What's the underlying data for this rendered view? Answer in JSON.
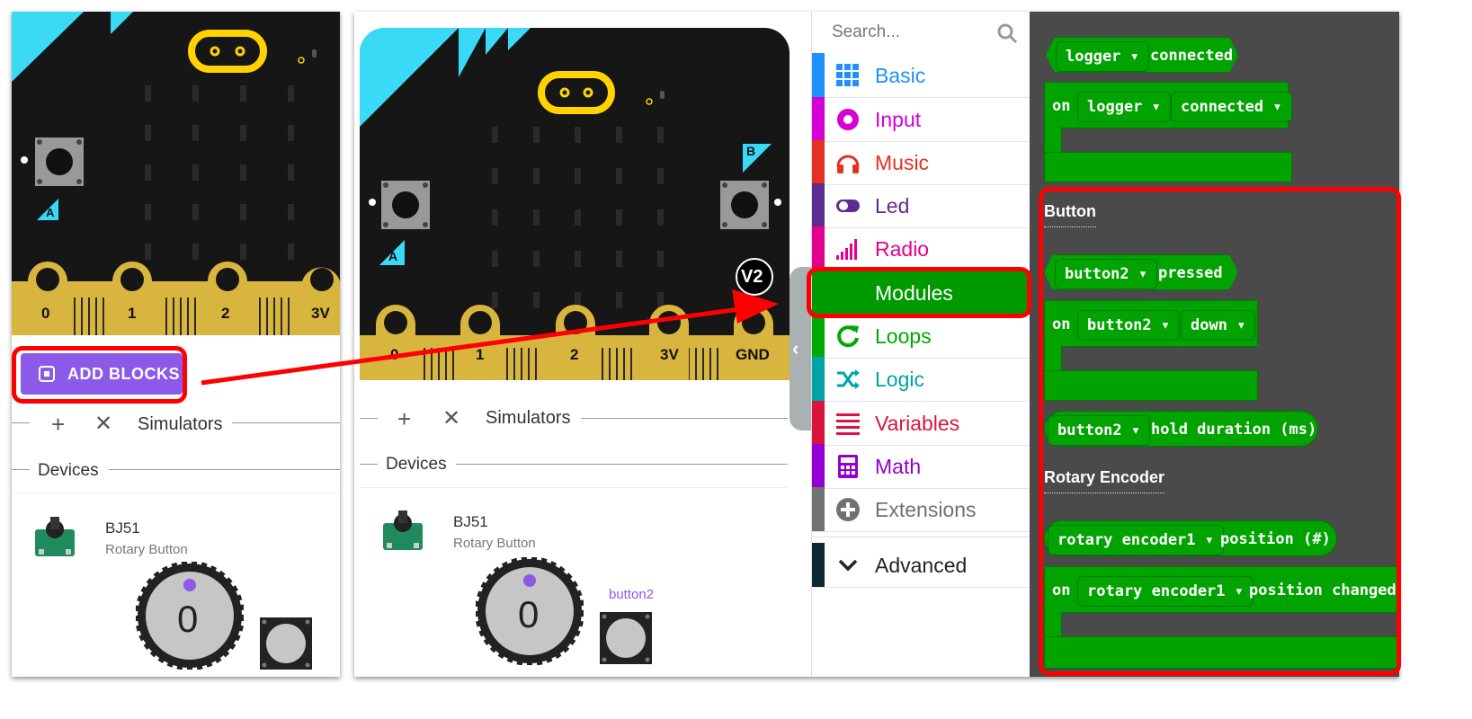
{
  "left_sim": {
    "pin_labels": [
      "0",
      "1",
      "2",
      "3V"
    ],
    "button_a": "A",
    "add_blocks": "ADD BLOCKS",
    "simulators_label": "Simulators",
    "devices_label": "Devices",
    "device_name": "BJ51",
    "device_sub": "Rotary Button",
    "knob_value": "0"
  },
  "right_sim": {
    "pin_labels": [
      "0",
      "1",
      "2",
      "3V",
      "GND"
    ],
    "button_a": "A",
    "button_b": "B",
    "version_badge": "V2",
    "simulators_label": "Simulators",
    "devices_label": "Devices",
    "device_name": "BJ51",
    "device_sub": "Rotary Button",
    "knob_value": "0",
    "button_label": "button2"
  },
  "toolbox": {
    "search_placeholder": "Search...",
    "items": [
      {
        "label": "Basic",
        "color": "#1e90ff",
        "icon": "grid-icon"
      },
      {
        "label": "Input",
        "color": "#d400d4",
        "icon": "radio-dot-icon"
      },
      {
        "label": "Music",
        "color": "#e63022",
        "icon": "headphones-icon"
      },
      {
        "label": "Led",
        "color": "#5c2d91",
        "icon": "toggle-icon"
      },
      {
        "label": "Radio",
        "color": "#e3008c",
        "icon": "signal-bars-icon"
      },
      {
        "label": "Modules",
        "color": "#009900",
        "icon": "none"
      },
      {
        "label": "Loops",
        "color": "#00aa00",
        "icon": "loop-arrow-icon"
      },
      {
        "label": "Logic",
        "color": "#00a4a6",
        "icon": "shuffle-icon"
      },
      {
        "label": "Variables",
        "color": "#dc143c",
        "icon": "lines-icon"
      },
      {
        "label": "Math",
        "color": "#9400d3",
        "icon": "calculator-icon"
      },
      {
        "label": "Extensions",
        "color": "#717171",
        "icon": "plus-circle-icon"
      },
      {
        "label": "Advanced",
        "color": "#0b2833",
        "icon": "chevron-down-icon"
      }
    ]
  },
  "blocks": {
    "logger_event": {
      "dropdown": "logger",
      "suffix": "connected"
    },
    "logger_on": {
      "prefix": "on",
      "dd1": "logger",
      "dd2": "connected"
    },
    "button_heading": "Button",
    "button_pressed": {
      "dropdown": "button2",
      "suffix": "pressed"
    },
    "button_on": {
      "prefix": "on",
      "dd1": "button2",
      "dd2": "down"
    },
    "button_hold": {
      "dropdown": "button2",
      "suffix": "hold duration (ms)"
    },
    "rotary_heading": "Rotary Encoder",
    "rotary_position": {
      "dropdown": "rotary encoder1",
      "suffix": "position (#)"
    },
    "rotary_on": {
      "prefix": "on",
      "dd1": "rotary encoder1",
      "suffix": "position changed"
    }
  }
}
